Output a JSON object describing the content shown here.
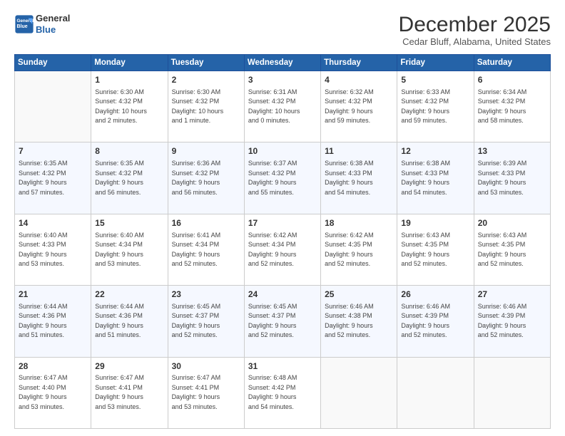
{
  "header": {
    "logo_line1": "General",
    "logo_line2": "Blue",
    "month_title": "December 2025",
    "location": "Cedar Bluff, Alabama, United States"
  },
  "weekdays": [
    "Sunday",
    "Monday",
    "Tuesday",
    "Wednesday",
    "Thursday",
    "Friday",
    "Saturday"
  ],
  "weeks": [
    [
      {
        "day": "",
        "info": ""
      },
      {
        "day": "1",
        "info": "Sunrise: 6:30 AM\nSunset: 4:32 PM\nDaylight: 10 hours\nand 2 minutes."
      },
      {
        "day": "2",
        "info": "Sunrise: 6:30 AM\nSunset: 4:32 PM\nDaylight: 10 hours\nand 1 minute."
      },
      {
        "day": "3",
        "info": "Sunrise: 6:31 AM\nSunset: 4:32 PM\nDaylight: 10 hours\nand 0 minutes."
      },
      {
        "day": "4",
        "info": "Sunrise: 6:32 AM\nSunset: 4:32 PM\nDaylight: 9 hours\nand 59 minutes."
      },
      {
        "day": "5",
        "info": "Sunrise: 6:33 AM\nSunset: 4:32 PM\nDaylight: 9 hours\nand 59 minutes."
      },
      {
        "day": "6",
        "info": "Sunrise: 6:34 AM\nSunset: 4:32 PM\nDaylight: 9 hours\nand 58 minutes."
      }
    ],
    [
      {
        "day": "7",
        "info": "Sunrise: 6:35 AM\nSunset: 4:32 PM\nDaylight: 9 hours\nand 57 minutes."
      },
      {
        "day": "8",
        "info": "Sunrise: 6:35 AM\nSunset: 4:32 PM\nDaylight: 9 hours\nand 56 minutes."
      },
      {
        "day": "9",
        "info": "Sunrise: 6:36 AM\nSunset: 4:32 PM\nDaylight: 9 hours\nand 56 minutes."
      },
      {
        "day": "10",
        "info": "Sunrise: 6:37 AM\nSunset: 4:32 PM\nDaylight: 9 hours\nand 55 minutes."
      },
      {
        "day": "11",
        "info": "Sunrise: 6:38 AM\nSunset: 4:33 PM\nDaylight: 9 hours\nand 54 minutes."
      },
      {
        "day": "12",
        "info": "Sunrise: 6:38 AM\nSunset: 4:33 PM\nDaylight: 9 hours\nand 54 minutes."
      },
      {
        "day": "13",
        "info": "Sunrise: 6:39 AM\nSunset: 4:33 PM\nDaylight: 9 hours\nand 53 minutes."
      }
    ],
    [
      {
        "day": "14",
        "info": "Sunrise: 6:40 AM\nSunset: 4:33 PM\nDaylight: 9 hours\nand 53 minutes."
      },
      {
        "day": "15",
        "info": "Sunrise: 6:40 AM\nSunset: 4:34 PM\nDaylight: 9 hours\nand 53 minutes."
      },
      {
        "day": "16",
        "info": "Sunrise: 6:41 AM\nSunset: 4:34 PM\nDaylight: 9 hours\nand 52 minutes."
      },
      {
        "day": "17",
        "info": "Sunrise: 6:42 AM\nSunset: 4:34 PM\nDaylight: 9 hours\nand 52 minutes."
      },
      {
        "day": "18",
        "info": "Sunrise: 6:42 AM\nSunset: 4:35 PM\nDaylight: 9 hours\nand 52 minutes."
      },
      {
        "day": "19",
        "info": "Sunrise: 6:43 AM\nSunset: 4:35 PM\nDaylight: 9 hours\nand 52 minutes."
      },
      {
        "day": "20",
        "info": "Sunrise: 6:43 AM\nSunset: 4:35 PM\nDaylight: 9 hours\nand 52 minutes."
      }
    ],
    [
      {
        "day": "21",
        "info": "Sunrise: 6:44 AM\nSunset: 4:36 PM\nDaylight: 9 hours\nand 51 minutes."
      },
      {
        "day": "22",
        "info": "Sunrise: 6:44 AM\nSunset: 4:36 PM\nDaylight: 9 hours\nand 51 minutes."
      },
      {
        "day": "23",
        "info": "Sunrise: 6:45 AM\nSunset: 4:37 PM\nDaylight: 9 hours\nand 52 minutes."
      },
      {
        "day": "24",
        "info": "Sunrise: 6:45 AM\nSunset: 4:37 PM\nDaylight: 9 hours\nand 52 minutes."
      },
      {
        "day": "25",
        "info": "Sunrise: 6:46 AM\nSunset: 4:38 PM\nDaylight: 9 hours\nand 52 minutes."
      },
      {
        "day": "26",
        "info": "Sunrise: 6:46 AM\nSunset: 4:39 PM\nDaylight: 9 hours\nand 52 minutes."
      },
      {
        "day": "27",
        "info": "Sunrise: 6:46 AM\nSunset: 4:39 PM\nDaylight: 9 hours\nand 52 minutes."
      }
    ],
    [
      {
        "day": "28",
        "info": "Sunrise: 6:47 AM\nSunset: 4:40 PM\nDaylight: 9 hours\nand 53 minutes."
      },
      {
        "day": "29",
        "info": "Sunrise: 6:47 AM\nSunset: 4:41 PM\nDaylight: 9 hours\nand 53 minutes."
      },
      {
        "day": "30",
        "info": "Sunrise: 6:47 AM\nSunset: 4:41 PM\nDaylight: 9 hours\nand 53 minutes."
      },
      {
        "day": "31",
        "info": "Sunrise: 6:48 AM\nSunset: 4:42 PM\nDaylight: 9 hours\nand 54 minutes."
      },
      {
        "day": "",
        "info": ""
      },
      {
        "day": "",
        "info": ""
      },
      {
        "day": "",
        "info": ""
      }
    ]
  ]
}
